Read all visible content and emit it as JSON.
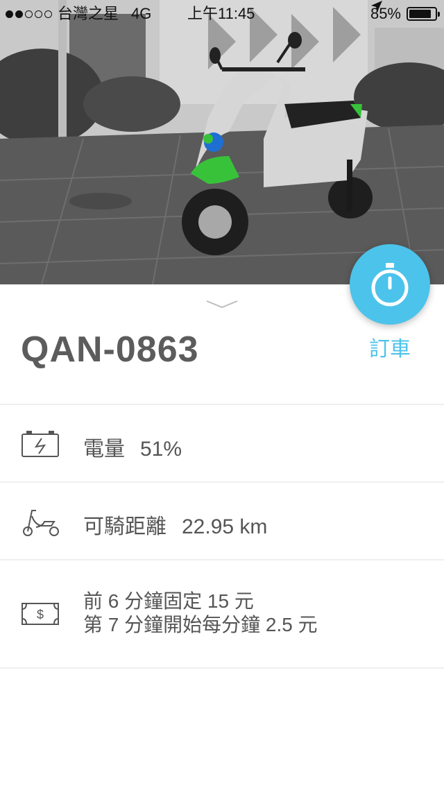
{
  "status_bar": {
    "carrier": "台灣之星",
    "network": "4G",
    "time": "上午11:45",
    "battery_percent": "85%",
    "battery_level": 0.85,
    "signal_filled": 2,
    "signal_total": 5
  },
  "vehicle": {
    "plate": "QAN-0863",
    "book_label": "訂車"
  },
  "details": {
    "battery_label": "電量",
    "battery_value": "51%",
    "range_label": "可騎距離",
    "range_value": "22.95 km",
    "fee_line1": "前 6 分鐘固定 15 元",
    "fee_line2": "第 7 分鐘開始每分鐘 2.5 元"
  },
  "colors": {
    "accent": "#4cc3ea",
    "text": "#555555",
    "divider": "#efefef"
  },
  "icons": [
    "location-arrow-icon",
    "battery-icon",
    "stopwatch-icon",
    "chevron-down-icon",
    "battery-charge-icon",
    "scooter-icon",
    "cash-icon"
  ]
}
